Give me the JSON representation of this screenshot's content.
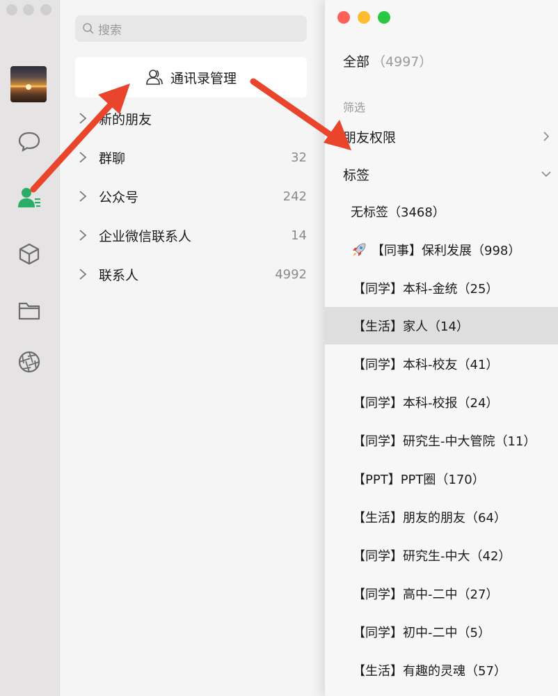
{
  "search": {
    "placeholder": "搜索"
  },
  "contacts_panel": {
    "manage_label": "通讯录管理",
    "groups": [
      {
        "label": "新的朋友",
        "count": ""
      },
      {
        "label": "群聊",
        "count": "32"
      },
      {
        "label": "公众号",
        "count": "242"
      },
      {
        "label": "企业微信联系人",
        "count": "14"
      },
      {
        "label": "联系人",
        "count": "4992"
      }
    ]
  },
  "filter_panel": {
    "all_label": "全部",
    "all_count": "（4997）",
    "filter_heading": "筛选",
    "friend_perm_label": "朋友权限",
    "tags_label": "标签",
    "tags": [
      "无标签（3468）",
      "【同事】保利发展（998）",
      "【同学】本科-金统（25）",
      "【生活】家人（14）",
      "【同学】本科-校友（41）",
      "【同学】本科-校报（24）",
      "【同学】研究生-中大管院（11）",
      "【PPT】PPT圈（170）",
      "【生活】朋友的朋友（64）",
      "【同学】研究生-中大（42）",
      "【同学】高中-二中（27）",
      "【同学】初中-二中（5）",
      "【生活】有趣的灵魂（57）"
    ],
    "selected_tag_index": 3
  },
  "colors": {
    "accent_green": "#2aae67",
    "arrow_red": "#e8452c",
    "traffic_close": "#fe5f57",
    "traffic_min": "#febc2e",
    "traffic_max": "#28c840"
  },
  "icons": [
    "chat-icon",
    "contacts-icon",
    "miniprogram-cube-icon",
    "folder-icon",
    "moments-aperture-icon",
    "search-icon",
    "contacts-manage-icon",
    "chevron-right-icon",
    "chevron-down-icon",
    "rocket-icon"
  ]
}
